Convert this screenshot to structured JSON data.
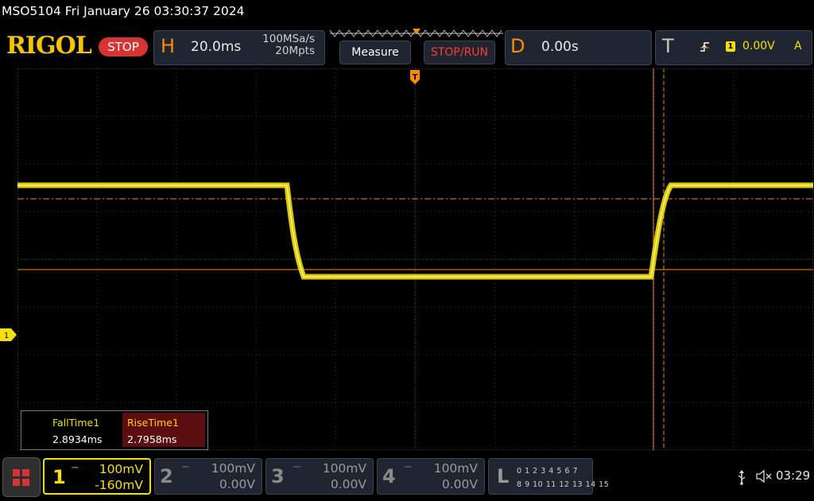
{
  "title_bar": {
    "model_datetime": "MSO5104  Fri January 26 03:30:37 2024"
  },
  "logo": {
    "text": "RIGOL"
  },
  "run_state": {
    "label": "STOP"
  },
  "horizontal": {
    "letter": "H",
    "timebase": "20.0ms",
    "sample_rate": "100MSa/s",
    "memory_depth": "20Mpts"
  },
  "buttons": {
    "measure": "Measure",
    "stop_run": "STOP/RUN"
  },
  "delay": {
    "letter": "D",
    "value": "0.00s"
  },
  "trigger": {
    "letter": "T",
    "source": "1",
    "level": "0.00V",
    "mode": "A",
    "edge_icon": "rising-edge-icon"
  },
  "measurements": {
    "fall": {
      "label": "FallTime1",
      "value": "2.8934ms"
    },
    "rise": {
      "label": "RiseTime1",
      "value": "2.7958ms"
    }
  },
  "channels": [
    {
      "number": "1",
      "scale": "100mV",
      "offset": "-160mV",
      "color": "#f5e000",
      "active": true
    },
    {
      "number": "2",
      "scale": "100mV",
      "offset": "0.00V",
      "color": "#9a9a9a",
      "active": false
    },
    {
      "number": "3",
      "scale": "100mV",
      "offset": "0.00V",
      "color": "#9a9a9a",
      "active": false
    },
    {
      "number": "4",
      "scale": "100mV",
      "offset": "0.00V",
      "color": "#9a9a9a",
      "active": false
    }
  ],
  "logic": {
    "letter": "L",
    "row1": "0 1 2 3   4 5 6 7",
    "row2": "8  9 10 11  12 13 14 15"
  },
  "ch1_marker": {
    "label": "1"
  },
  "status": {
    "time": "03:29",
    "usb_icon": "usb-icon",
    "speaker_icon": "speaker-muted-icon"
  },
  "colors": {
    "ch1": "#f5e000",
    "accent_orange": "#ff8a00",
    "stop_red": "#d83232",
    "panel": "#1f2631"
  }
}
